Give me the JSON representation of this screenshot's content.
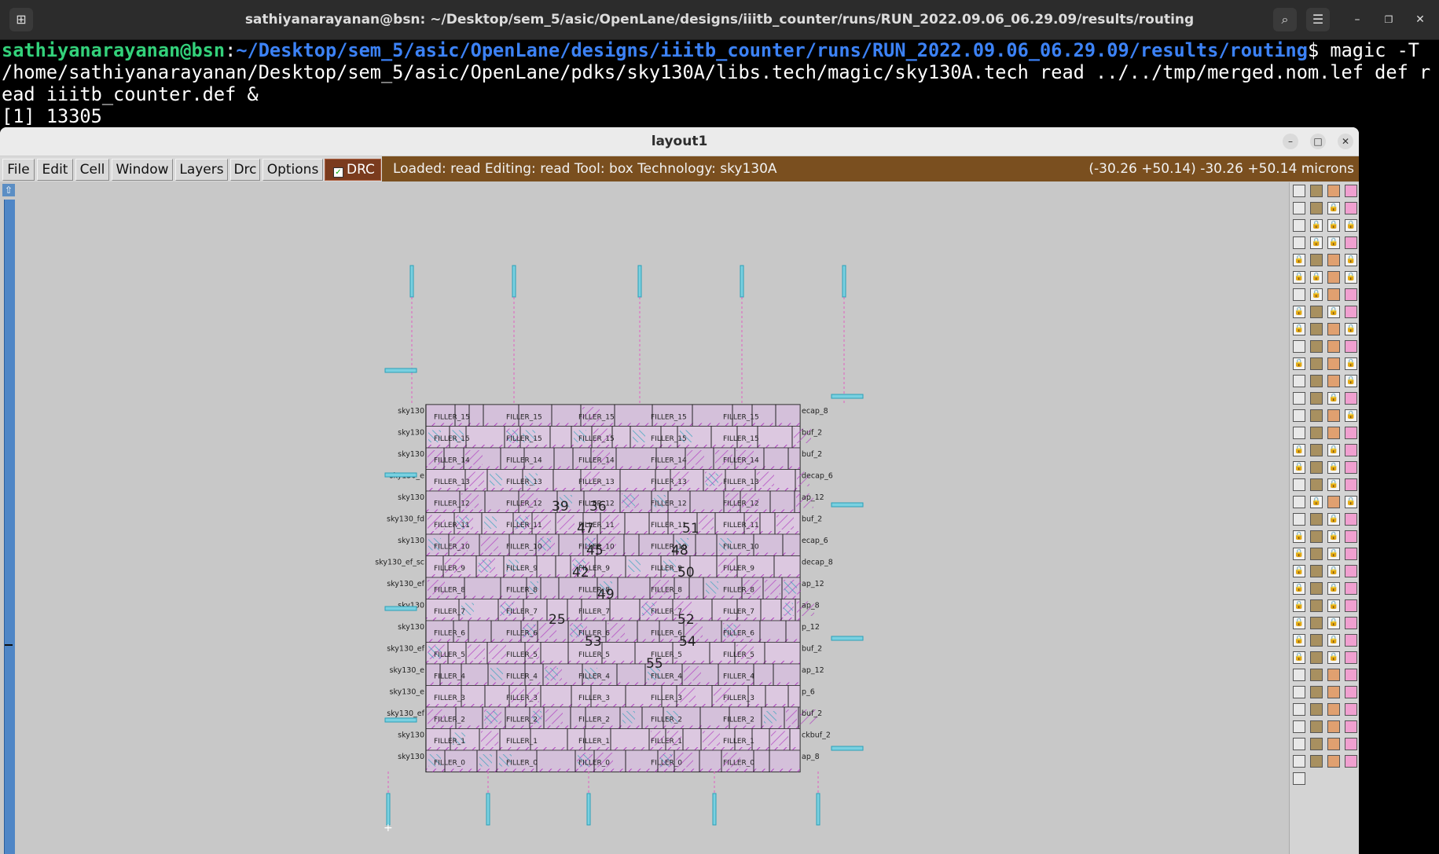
{
  "terminal": {
    "title": "sathiyanarayanan@bsn: ~/Desktop/sem_5/asic/OpenLane/designs/iiitb_counter/runs/RUN_2022.09.06_06.29.09/results/routing",
    "prompt_user": "sathiyanarayanan@bsn",
    "prompt_sep": ":",
    "prompt_path": "~/Desktop/sem_5/asic/OpenLane/designs/iiitb_counter/runs/RUN_2022.09.06_06.29.09/results/routing",
    "command": "$ magic -T /home/sathiyanarayanan/Desktop/sem_5/asic/OpenLane/pdks/sky130A/libs.tech/magic/sky130A.tech read ../../tmp/merged.nom.lef def read iiitb_counter.def &",
    "job_output": "[1] 13305",
    "icons": [
      "new-tab-icon",
      "search-icon",
      "hamburger-menu-icon",
      "minimize-icon",
      "maximize-icon",
      "close-icon"
    ]
  },
  "layout_window": {
    "title": "layout1",
    "menus": [
      "File",
      "Edit",
      "Cell",
      "Window",
      "Layers",
      "Drc",
      "Options"
    ],
    "drc_label": "DRC",
    "drc_checked": true,
    "status_left": "Loaded: read  Editing: read  Tool: box   Technology: sky130A",
    "status_right": "(-30.26 +50.14) -30.26 +50.14 microns",
    "status_bar_color": "#7a4f1f"
  },
  "layout": {
    "row_labels_left": [
      "sky130",
      "sky130",
      "sky130",
      "sky130_e",
      "sky130",
      "sky130_fd",
      "sky130",
      "sky130_ef_sc",
      "sky130_ef",
      "sky130",
      "sky130",
      "sky130_ef",
      "sky130_e",
      "sky130_e",
      "sky130_ef",
      "sky130",
      "sky130"
    ],
    "row_labels_right": [
      "ecap_8",
      "buf_2",
      "buf_2",
      "decap_6",
      "ap_12",
      "buf_2",
      "ecap_6",
      "decap_8",
      "ap_12",
      "ap_8",
      "p_12",
      "buf_2",
      "ap_12",
      "p_6",
      "buf_2",
      "ckbuf_2",
      "ap_8"
    ],
    "filler_words": [
      "FILLER_15",
      "FILLER_14",
      "FILLER_13",
      "FILLER_12",
      "FILLER_11",
      "FILLER_10",
      "FILLER_9",
      "FILLER_8",
      "FILLER_7",
      "FILLER_6",
      "FILLER_5",
      "FILLER_4",
      "FILLER_3",
      "FILLER_2",
      "FILLER_1",
      "FILLER_0"
    ],
    "instance_numbers": [
      "39",
      "36",
      "47",
      "51",
      "45",
      "48",
      "42",
      "50",
      "49",
      "25",
      "52",
      "53",
      "54",
      "55"
    ]
  }
}
